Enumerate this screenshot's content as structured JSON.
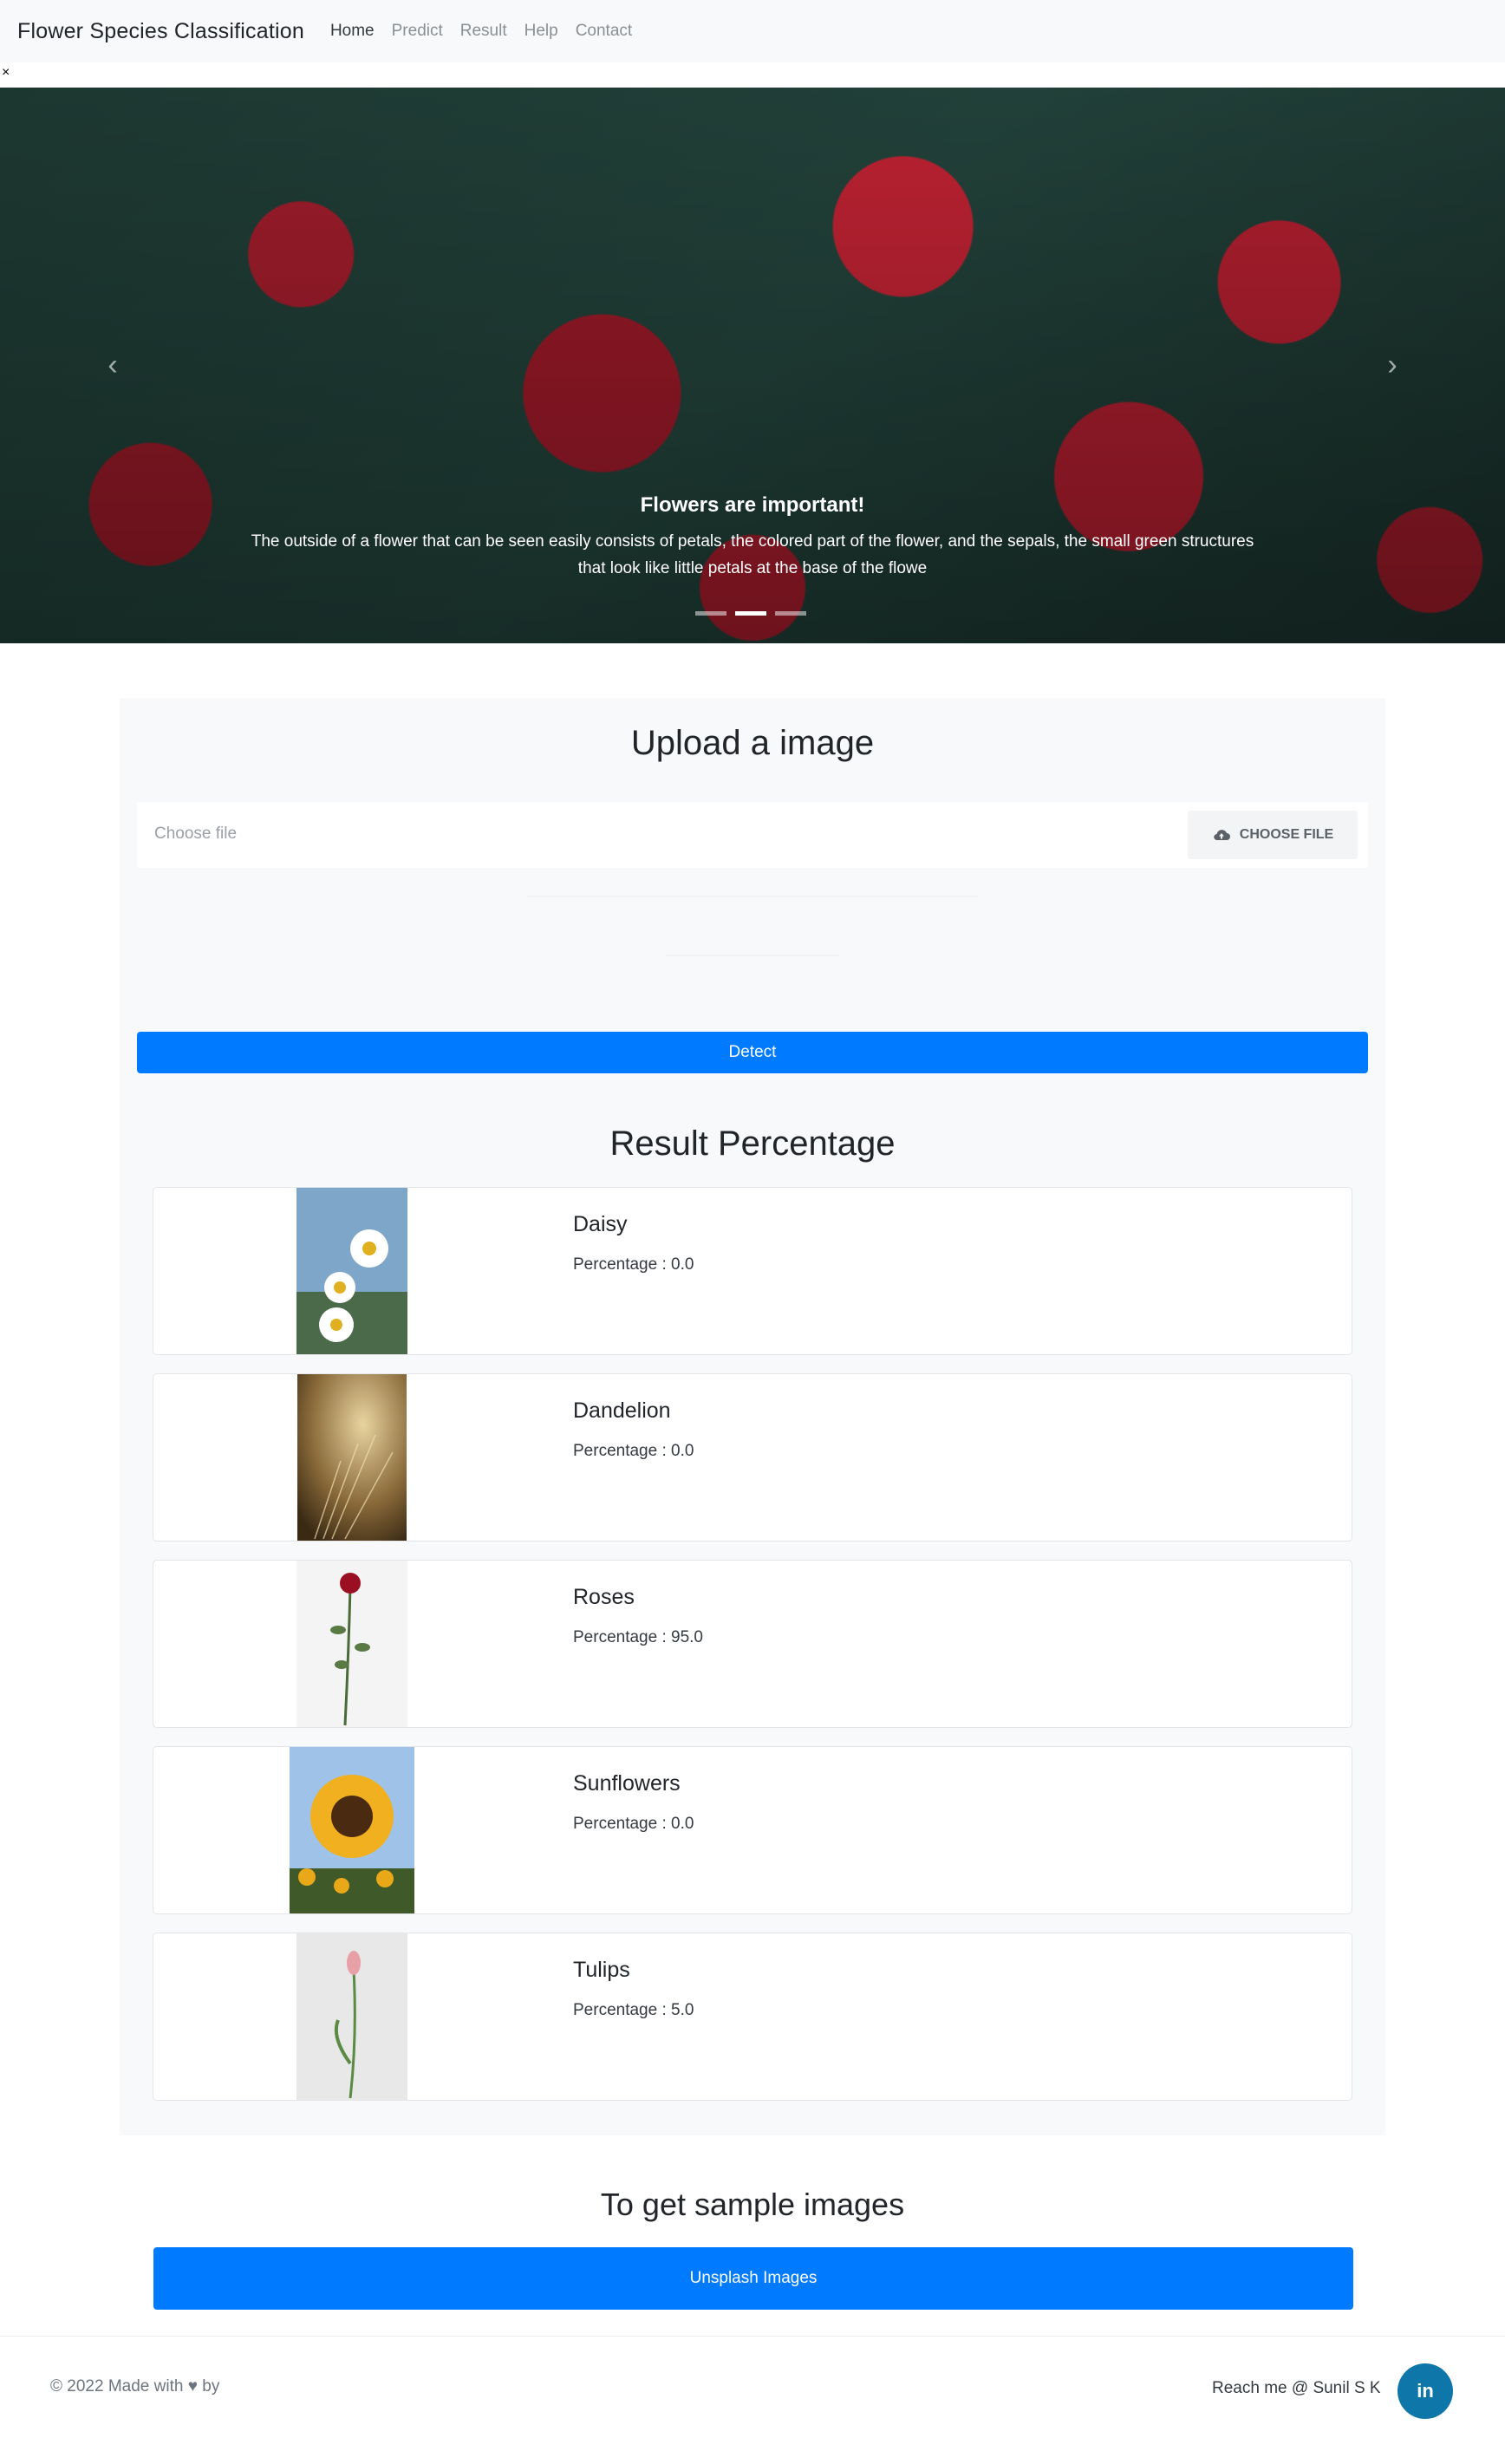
{
  "navbar": {
    "brand": "Flower Species Classification",
    "links": [
      "Home",
      "Predict",
      "Result",
      "Help",
      "Contact"
    ],
    "close_glyph": "×"
  },
  "carousel": {
    "caption_title": "Flowers are important!",
    "caption_text": "The outside of a flower that can be seen easily consists of petals, the colored part of the flower, and the sepals, the small green structures that look like little petals at the base of the flowe",
    "prev_glyph": "‹",
    "next_glyph": "›",
    "indicator_count": 3,
    "active_indicator": 1
  },
  "upload": {
    "title": "Upload a image",
    "placeholder": "Choose file",
    "choose_label": "CHOOSE FILE",
    "choose_icon": "cloud-upload-icon",
    "detect_label": "Detect"
  },
  "results": {
    "title": "Result Percentage",
    "items": [
      {
        "name": "Daisy",
        "percentage": "Percentage : 0.0"
      },
      {
        "name": "Dandelion",
        "percentage": "Percentage : 0.0"
      },
      {
        "name": "Roses",
        "percentage": "Percentage : 95.0"
      },
      {
        "name": "Sunflowers",
        "percentage": "Percentage : 0.0"
      },
      {
        "name": "Tulips",
        "percentage": "Percentage : 5.0"
      }
    ]
  },
  "sample": {
    "title": "To get sample images",
    "button_label": "Unsplash Images"
  },
  "footer": {
    "left_text": "© 2022 Made with ♥ by",
    "right_text": "Reach me @ Sunil S K",
    "linkedin_label": "in"
  },
  "colors": {
    "primary": "#007bff",
    "panel_bg": "#f8f9fa",
    "linkedin": "#0e76a8"
  }
}
